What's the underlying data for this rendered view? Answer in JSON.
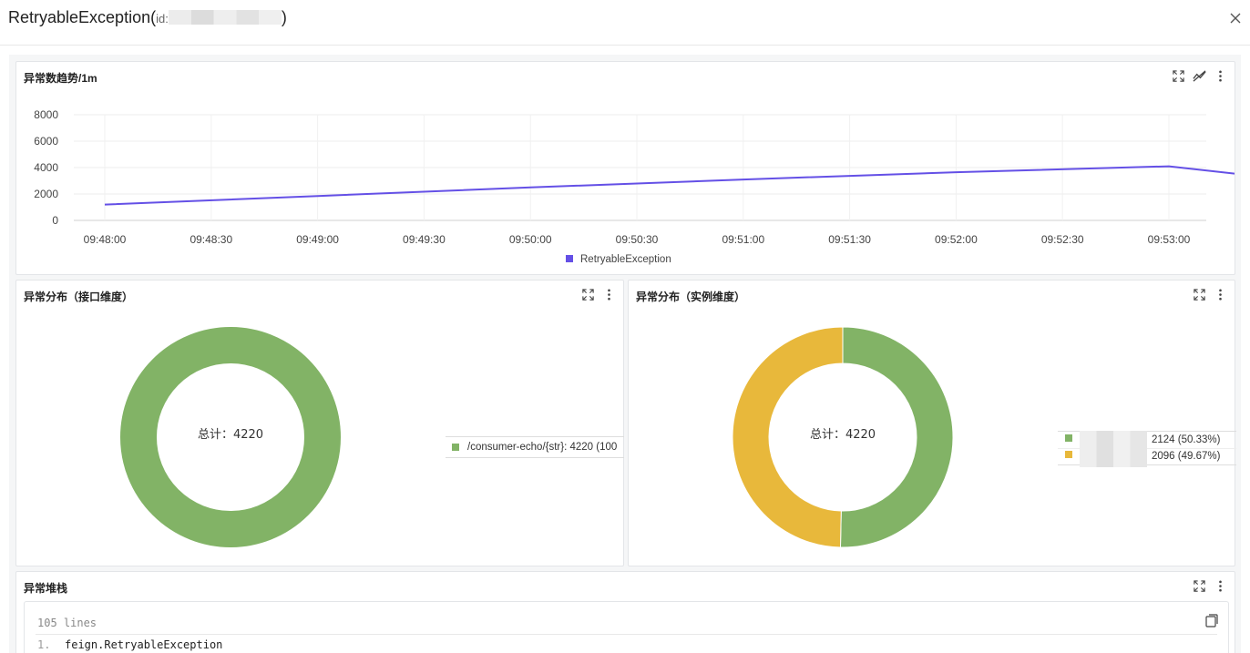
{
  "dialog": {
    "title": "RetryableException",
    "id_label": "id:",
    "open_paren": "(",
    "close_paren": ")"
  },
  "trend_panel": {
    "title": "异常数趋势/1m",
    "icons": [
      "expand-icon",
      "line-chart-icon",
      "more-vertical-icon"
    ]
  },
  "interface_panel": {
    "title": "异常分布（接口维度）",
    "total_label": "总计：4220",
    "legend": [
      {
        "label": "/consumer-echo/{str}: 4220 (100",
        "color": "#82b366"
      }
    ]
  },
  "instance_panel": {
    "title": "异常分布（实例维度）",
    "total_label": "总计：4220",
    "legend": [
      {
        "label": "2124 (50.33%)",
        "color": "#82b366"
      },
      {
        "label": "2096 (49.67%)",
        "color": "#e8b83b"
      }
    ]
  },
  "stack_panel": {
    "title": "异常堆栈",
    "lines_count": "105 lines",
    "lines": [
      {
        "num": "1.",
        "text": "feign.RetryableException"
      }
    ]
  },
  "chart_data": [
    {
      "type": "line",
      "title": "异常数趋势/1m",
      "x": [
        "09:48:00",
        "09:48:30",
        "09:49:00",
        "09:49:30",
        "09:50:00",
        "09:50:30",
        "09:51:00",
        "09:51:30",
        "09:52:00",
        "09:52:30",
        "09:53:00"
      ],
      "x_ticks": [
        "09:48:00",
        "09:48:30",
        "09:49:00",
        "09:49:30",
        "09:50:00",
        "09:50:30",
        "09:51:00",
        "09:51:30",
        "09:52:00",
        "09:52:30",
        "09:53:00"
      ],
      "series": [
        {
          "name": "RetryableException",
          "color": "#6450e6",
          "points": [
            [
              "09:48:00",
              1200
            ],
            [
              "09:49:00",
              1850
            ],
            [
              "09:50:00",
              2500
            ],
            [
              "09:51:00",
              3100
            ],
            [
              "09:52:00",
              3650
            ],
            [
              "09:53:00",
              4100
            ],
            [
              "09:53:20",
              3500
            ]
          ]
        }
      ],
      "y_ticks": [
        0,
        2000,
        4000,
        6000,
        8000
      ],
      "ylim": [
        0,
        8000
      ],
      "legend": "bottom-center",
      "grid": true
    },
    {
      "type": "pie",
      "title": "异常分布（接口维度）",
      "slices": [
        {
          "label": "/consumer-echo/{str}",
          "value": 4220,
          "percent": 100,
          "color": "#82b366"
        }
      ],
      "total": 4220
    },
    {
      "type": "pie",
      "title": "异常分布（实例维度）",
      "slices": [
        {
          "value": 2124,
          "percent": 50.33,
          "color": "#82b366"
        },
        {
          "value": 2096,
          "percent": 49.67,
          "color": "#e8b83b"
        }
      ],
      "total": 4220
    }
  ]
}
